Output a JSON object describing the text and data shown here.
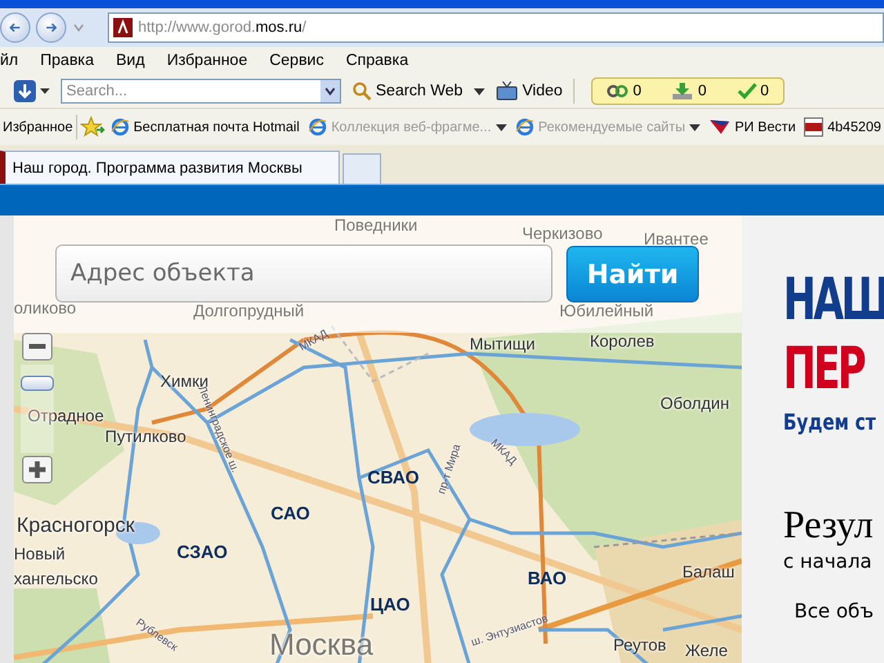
{
  "address_bar": {
    "url_start": "http://www.gorod.",
    "url_host": "mos.ru",
    "url_end": "/"
  },
  "menu": [
    {
      "label": "йл"
    },
    {
      "label": "Правка"
    },
    {
      "label": "Вид"
    },
    {
      "label": "Избранное"
    },
    {
      "label": "Сервис"
    },
    {
      "label": "Справка"
    }
  ],
  "search_toolbar": {
    "placeholder": "Search...",
    "search_button": "Search Web",
    "video_button": "Video",
    "counters": [
      {
        "kind": "links",
        "value": "0"
      },
      {
        "kind": "download",
        "value": "0"
      },
      {
        "kind": "check",
        "value": "0"
      }
    ]
  },
  "favorites_bar": {
    "label": "Избранное",
    "links": [
      {
        "kind": "ie",
        "label": "Бесплатная почта Hotmail",
        "disabled": false,
        "dropdown": false
      },
      {
        "kind": "ie",
        "label": "Коллекция веб-фрагме...",
        "disabled": true,
        "dropdown": true
      },
      {
        "kind": "ie",
        "label": "Рекомендуемые сайты",
        "disabled": true,
        "dropdown": true
      },
      {
        "kind": "flag",
        "label": "РИ Вести",
        "disabled": false,
        "dropdown": false
      },
      {
        "kind": "png",
        "label": "4b45209",
        "disabled": false
      }
    ]
  },
  "tabs": [
    {
      "label": "Наш город. Программа развития Москвы",
      "selected": true
    }
  ],
  "page": {
    "address_search": {
      "placeholder": "Адрес объекта",
      "button": "Найти"
    },
    "zoom": {
      "level": 0.85
    },
    "map": {
      "places": [
        {
          "name": "Поведники",
          "faded": true
        },
        {
          "name": "Черкизово",
          "faded": true
        },
        {
          "name": "Ивантее",
          "faded": true
        },
        {
          "name": "оликово",
          "faded": true
        },
        {
          "name": "Долгопрудный",
          "faded": true
        },
        {
          "name": "Юбилейный",
          "faded": true
        },
        {
          "name": "Мытищи",
          "faded": false
        },
        {
          "name": "Королев",
          "faded": false
        },
        {
          "name": "Химки",
          "faded": false
        },
        {
          "name": "Отрадное",
          "faded": false
        },
        {
          "name": "Путилково",
          "faded": false
        },
        {
          "name": "Оболдин",
          "faded": false
        },
        {
          "name": "Красногорск",
          "faded": false
        },
        {
          "name": "Новый",
          "faded": false
        },
        {
          "name": "хангельско",
          "faded": false
        },
        {
          "name": "Балаш",
          "faded": false
        },
        {
          "name": "Москва",
          "faded": true
        },
        {
          "name": "Реутов",
          "faded": false
        },
        {
          "name": "Желе",
          "faded": false
        }
      ],
      "districts": [
        {
          "name": "СВАО"
        },
        {
          "name": "САО"
        },
        {
          "name": "СЗАО"
        },
        {
          "name": "ВАО"
        },
        {
          "name": "ЦАО"
        }
      ],
      "roads": [
        {
          "name": "МКАД"
        },
        {
          "name": "Ленинградское ш."
        },
        {
          "name": "пр-т Мира"
        },
        {
          "name": "МКАД"
        },
        {
          "name": "ш. Энтузиастов"
        },
        {
          "name": "Рублевск"
        }
      ]
    },
    "promo": {
      "title_line_1": "НАШ",
      "title_line_2": "ПЕР",
      "subtitle": "Будем ст",
      "results_heading": "Резул",
      "results_sub": "с начала",
      "all_objects": "Все объ"
    }
  }
}
